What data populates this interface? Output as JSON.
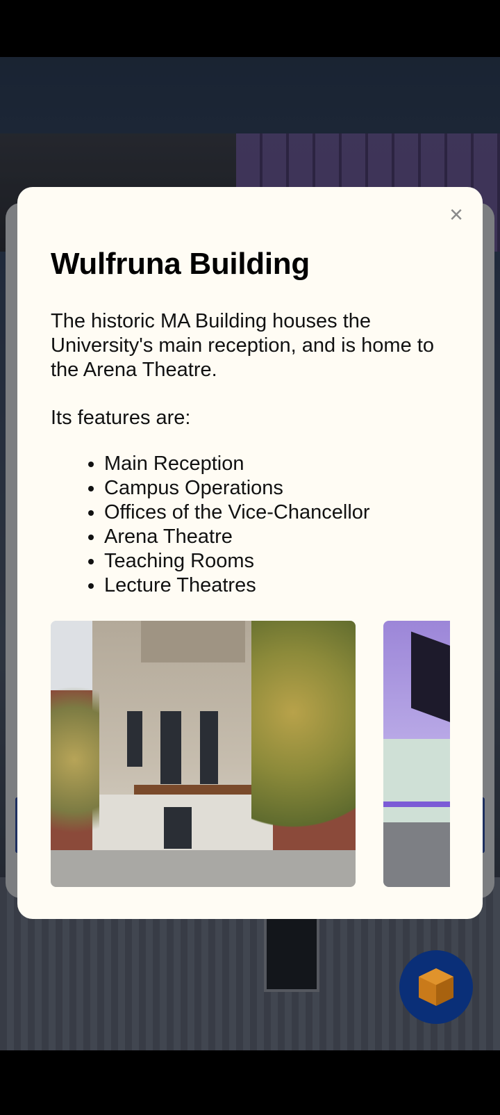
{
  "modal": {
    "title": "Wulfruna Building",
    "close_symbol": "×",
    "description": "The historic MA Building houses the University's main reception, and is home to the Arena Theatre.",
    "features_intro": "Its features are:",
    "features": [
      "Main Reception",
      "Campus Operations",
      "Offices of the Vice-Chancellor",
      "Arena Theatre",
      "Teaching Rooms",
      "Lecture Theatres"
    ]
  },
  "gallery": {
    "photos": [
      "wulfruna-building-exterior-photo",
      "arena-theatre-interior-photo"
    ]
  },
  "fab": {
    "icon": "cube-icon"
  },
  "colors": {
    "modal_bg": "#fffcf4",
    "fab_bg": "#0a2f78",
    "fab_icon": "#c97a1a",
    "close_icon": "#8a8a8a"
  }
}
